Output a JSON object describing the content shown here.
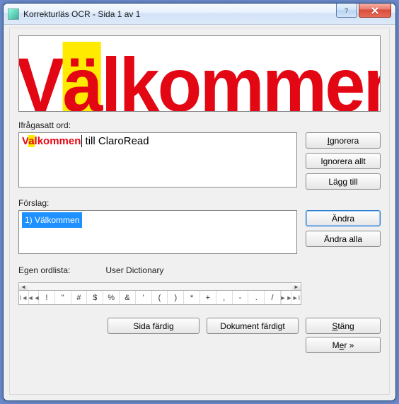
{
  "title": "Korrekturläs OCR - Sida 1 av 1",
  "preview_word_pre": "V",
  "preview_word_hl": "ä",
  "preview_word_post": "lkommen",
  "labels": {
    "questioned": "Ifrågasatt ord:",
    "suggestions": "Förslag:",
    "own_dict": "Egen ordlista:",
    "dict_name": "User Dictionary"
  },
  "questioned": {
    "pre": "V",
    "hl": "a",
    "post": "lkommen",
    "rest": " till ClaroRead"
  },
  "suggestions": [
    "1) Välkommen"
  ],
  "buttons": {
    "ignore": "Ignorera",
    "ignore_all": "Ignorera allt",
    "add": "Lägg till",
    "change": "Ändra",
    "change_all": "Ändra alla",
    "more_pre": "M",
    "more_u": "e",
    "more_post": "r »",
    "page_done": "Sida färdig",
    "doc_done": "Dokument färdigt",
    "close_pre": "",
    "close_u": "S",
    "close_post": "täng",
    "I_u": "I",
    "I_post": "gnorera"
  },
  "chars": [
    "!",
    "\"",
    "#",
    "$",
    "%",
    "&",
    "'",
    "(",
    ")",
    "*",
    "+",
    ",",
    "-",
    ".",
    "/"
  ]
}
